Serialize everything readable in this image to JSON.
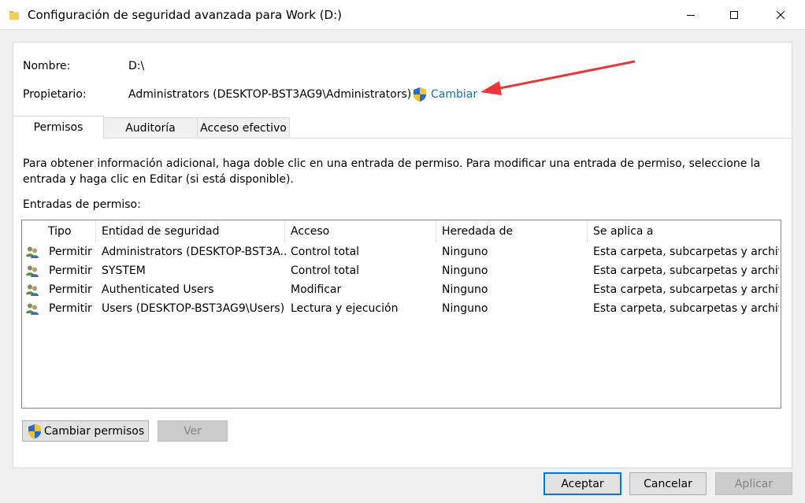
{
  "window": {
    "title": "Configuración de seguridad avanzada para Work (D:)",
    "folder_icon": "folder-icon",
    "minimize_icon": "minimize-icon",
    "maximize_icon": "maximize-icon",
    "close_icon": "close-icon"
  },
  "object": {
    "name_label": "Nombre:",
    "name_value": "D:\\",
    "owner_label": "Propietario:",
    "owner_value": "Administrators (DESKTOP-BST3AG9\\Administrators)",
    "change_link": "Cambiar",
    "change_icon": "uac-shield-icon"
  },
  "tabs": [
    {
      "label": "Permisos",
      "active": true
    },
    {
      "label": "Auditoría",
      "active": false
    },
    {
      "label": "Acceso efectivo",
      "active": false
    }
  ],
  "info_text": "Para obtener información adicional, haga doble clic en una entrada de permiso. Para modificar una entrada de permiso, seleccione la entrada y haga clic en Editar (si está disponible).",
  "entries_label": "Entradas de permiso:",
  "columns": [
    "Tipo",
    "Entidad de seguridad",
    "Acceso",
    "Heredada de",
    "Se aplica a"
  ],
  "rows": [
    {
      "icon": "users-group-icon",
      "tipo": "Permitir",
      "entidad": "Administrators (DESKTOP-BST3A...",
      "acceso": "Control total",
      "heredada": "Ninguno",
      "aplica": "Esta carpeta, subcarpetas y archiv..."
    },
    {
      "icon": "users-group-icon",
      "tipo": "Permitir",
      "entidad": "SYSTEM",
      "acceso": "Control total",
      "heredada": "Ninguno",
      "aplica": "Esta carpeta, subcarpetas y archiv..."
    },
    {
      "icon": "users-group-icon",
      "tipo": "Permitir",
      "entidad": "Authenticated Users",
      "acceso": "Modificar",
      "heredada": "Ninguno",
      "aplica": "Esta carpeta, subcarpetas y archiv..."
    },
    {
      "icon": "users-group-icon",
      "tipo": "Permitir",
      "entidad": "Users (DESKTOP-BST3AG9\\Users)",
      "acceso": "Lectura y ejecución",
      "heredada": "Ninguno",
      "aplica": "Esta carpeta, subcarpetas y archiv..."
    }
  ],
  "buttons": {
    "change_permissions": "Cambiar permisos",
    "view": "Ver",
    "ok": "Aceptar",
    "cancel": "Cancelar",
    "apply": "Aplicar"
  },
  "colors": {
    "link": "#1a6fb5",
    "annotation_arrow": "#e8363b",
    "default_button_border": "#0078d7"
  }
}
